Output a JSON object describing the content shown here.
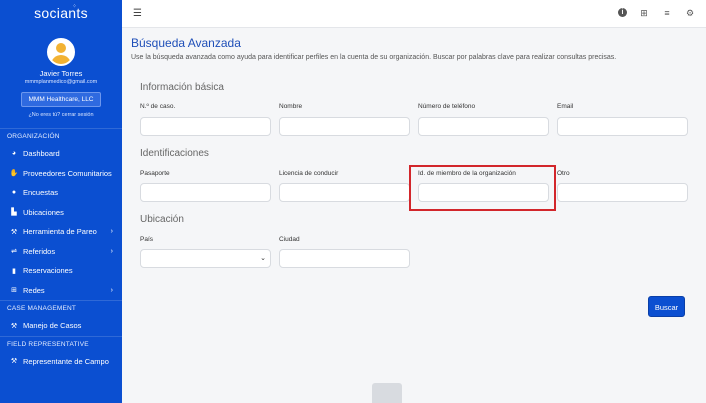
{
  "app": {
    "logo": "sociants"
  },
  "user": {
    "name": "Javier Torres",
    "email": "mmmplanmedico@gmail.com",
    "org": "MMM Healthcare, LLC",
    "logout": "¿No eres tú? cerrar sesión"
  },
  "sidebar": {
    "section1": "ORGANIZACIÓN",
    "items": [
      {
        "label": "Dashboard",
        "icon": "palette-icon"
      },
      {
        "label": "Proveedores Comunitarios",
        "icon": "handshake-icon"
      },
      {
        "label": "Encuestas",
        "icon": "comments-icon"
      },
      {
        "label": "Ubicaciones",
        "icon": "building-icon"
      },
      {
        "label": "Herramienta de Pareo",
        "icon": "magic-icon"
      },
      {
        "label": "Referidos",
        "icon": "exchange-icon"
      },
      {
        "label": "Reservaciones",
        "icon": "book-icon"
      },
      {
        "label": "Redes",
        "icon": "sitemap-icon"
      }
    ],
    "section2": "CASE MANAGEMENT",
    "case_item": "Manejo de Casos",
    "section3": "FIELD REPRESENTATIVE",
    "field_item": "Representante de Campo"
  },
  "page": {
    "title": "Búsqueda Avanzada",
    "subtitle": "Use la búsqueda avanzada como ayuda para identificar perfiles en la cuenta de su organización. Buscar por palabras clave para realizar consultas precisas."
  },
  "sections": {
    "basic": "Información básica",
    "ids": "Identificaciones",
    "location": "Ubicación"
  },
  "fields": {
    "case_no": "N.º de caso.",
    "name": "Nombre",
    "phone": "Número de teléfono",
    "email": "Email",
    "passport": "Pasaporte",
    "license": "Licencia de conducir",
    "member_id": "Id. de miembro de la organización",
    "other": "Otro",
    "country": "País",
    "city": "Ciudad"
  },
  "actions": {
    "search": "Buscar"
  }
}
